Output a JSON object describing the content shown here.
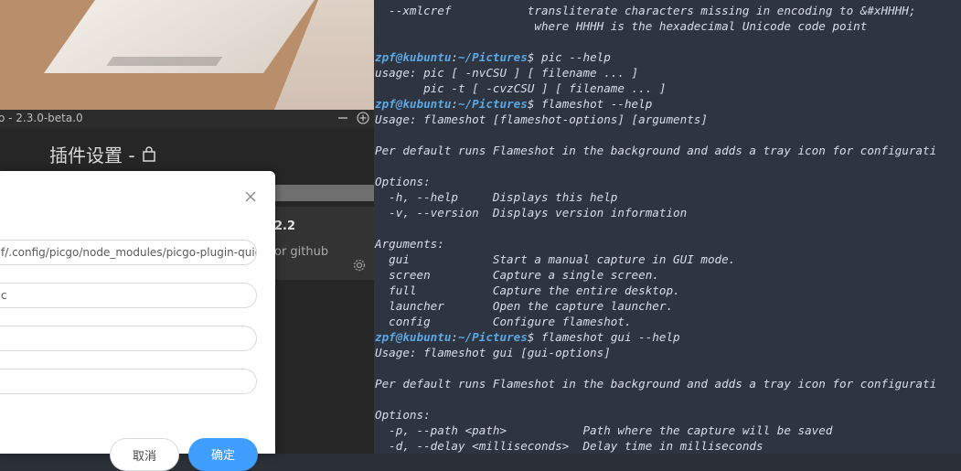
{
  "app_window": {
    "title": "o - 2.3.0-beta.0",
    "minimize_symbol": "—",
    "plugin_settings_title": "插件设置 -",
    "plugin_card": {
      "version": "2.2",
      "description": "or github"
    }
  },
  "dialog": {
    "close_symbol": "×",
    "fields": [
      {
        "value": "f/.config/picgo/node_modules/picgo-plugin-quick-c"
      },
      {
        "value": "c"
      },
      {
        "value": ""
      },
      {
        "value": ""
      }
    ],
    "cancel_label": "取消",
    "ok_label": "确定",
    "accent": "#409eff"
  },
  "terminal": {
    "background": "#2e3440",
    "lines": [
      {
        "text": "  --xmlcref           transliterate characters missing in encoding to &#xHHHH;"
      },
      {
        "text": "                       where HHHH is the hexadecimal Unicode code point"
      },
      {
        "text": ""
      },
      {
        "prompt_user": "zpf@kubuntu",
        "prompt_path": "~/Pictures",
        "command": "$ pic --help"
      },
      {
        "text": "usage: pic [ -nvCSU ] [ filename ... ]"
      },
      {
        "text": "       pic -t [ -cvzCSU ] [ filename ... ]"
      },
      {
        "prompt_user": "zpf@kubuntu",
        "prompt_path": "~/Pictures",
        "command": "$ flameshot --help"
      },
      {
        "text": "Usage: flameshot [flameshot-options] [arguments]"
      },
      {
        "text": ""
      },
      {
        "text": "Per default runs Flameshot in the background and adds a tray icon for configurati"
      },
      {
        "text": ""
      },
      {
        "text": "Options:"
      },
      {
        "text": "  -h, --help     Displays this help"
      },
      {
        "text": "  -v, --version  Displays version information"
      },
      {
        "text": ""
      },
      {
        "text": "Arguments:"
      },
      {
        "text": "  gui            Start a manual capture in GUI mode."
      },
      {
        "text": "  screen         Capture a single screen."
      },
      {
        "text": "  full           Capture the entire desktop."
      },
      {
        "text": "  launcher       Open the capture launcher."
      },
      {
        "text": "  config         Configure flameshot."
      },
      {
        "prompt_user": "zpf@kubuntu",
        "prompt_path": "~/Pictures",
        "command": "$ flameshot gui --help"
      },
      {
        "text": "Usage: flameshot gui [gui-options]"
      },
      {
        "text": ""
      },
      {
        "text": "Per default runs Flameshot in the background and adds a tray icon for configurati"
      },
      {
        "text": ""
      },
      {
        "text": "Options:"
      },
      {
        "text": "  -p, --path <path>           Path where the capture will be saved"
      },
      {
        "text": "  -d, --delay <milliseconds>  Delay time in milliseconds"
      }
    ]
  }
}
